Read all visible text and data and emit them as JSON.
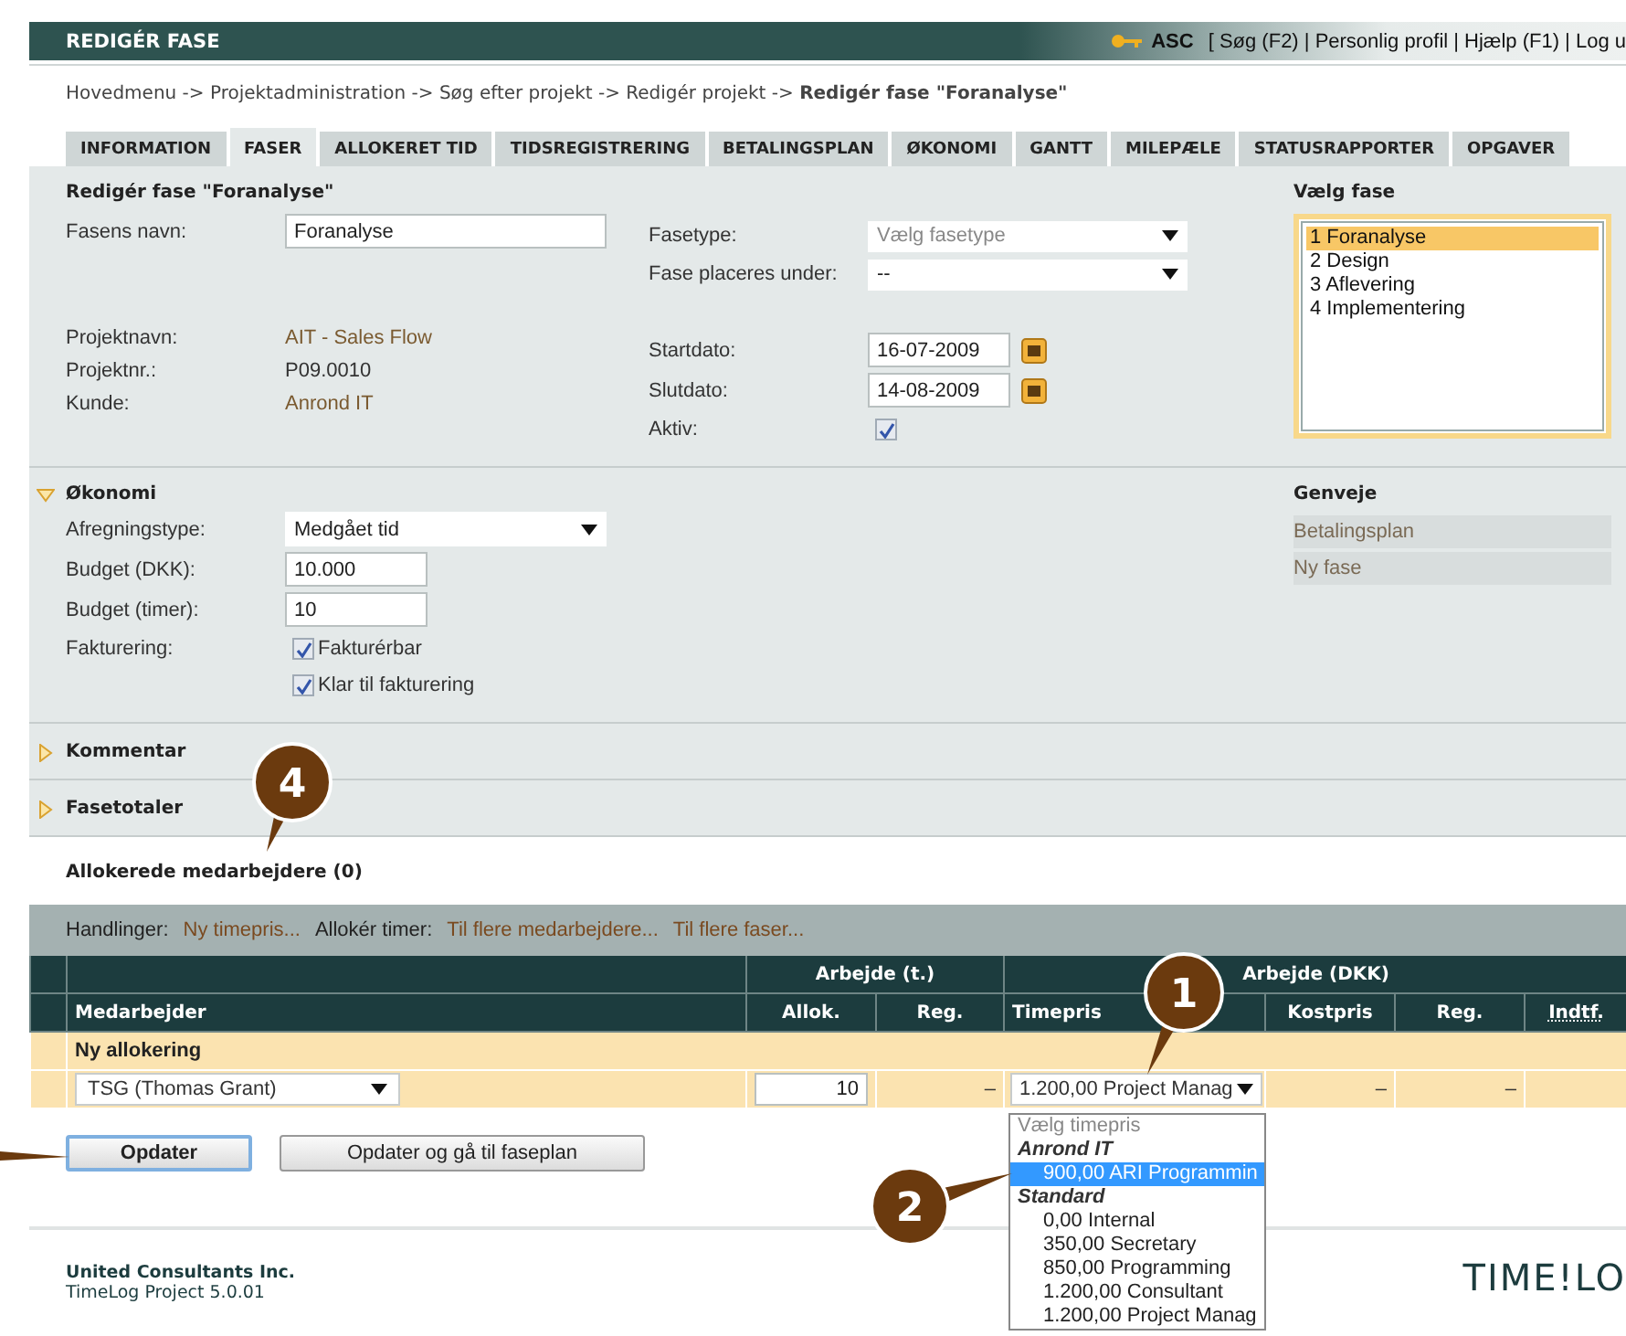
{
  "header": {
    "title": "REDIGÉR FASE",
    "user": "ASC",
    "links": "[ Søg (F2) | Personlig profil | Hjælp (F1) | Log u"
  },
  "breadcrumb": "Hovedmenu -> Projektadministration -> Søg efter projekt -> Redigér projekt -> **Redigér fase \"Foranalyse\"**",
  "tabs": [
    {
      "label": "INFORMATION",
      "selected": false
    },
    {
      "label": "FASER",
      "selected": true
    },
    {
      "label": "ALLOKERET TID",
      "selected": false
    },
    {
      "label": "TIDSREGISTRERING",
      "selected": false
    },
    {
      "label": "BETALINGSPLAN",
      "selected": false
    },
    {
      "label": "ØKONOMI",
      "selected": false
    },
    {
      "label": "GANTT",
      "selected": false
    },
    {
      "label": "MILEPÆLE",
      "selected": false
    },
    {
      "label": "STATUSRAPPORTER",
      "selected": false
    },
    {
      "label": "OPGAVER",
      "selected": false
    }
  ],
  "phase_form": {
    "title": "Redigér fase \"Foranalyse\"",
    "name": {
      "label": "Fasens navn:",
      "value": "Foranalyse"
    },
    "info": [
      {
        "label": "Projektnavn:",
        "value": "AIT - Sales Flow",
        "kind": "link"
      },
      {
        "label": "Projektnr.:",
        "value": "P09.0010",
        "kind": "text"
      },
      {
        "label": "Kunde:",
        "value": "Anrond IT",
        "kind": "link"
      }
    ],
    "phase_type": {
      "label": "Fasetype:",
      "placeholder": "Vælg fasetype"
    },
    "placed_under": {
      "label": "Fase placeres under:",
      "value": "--"
    },
    "start_date": {
      "label": "Startdato:",
      "value": "16-07-2009"
    },
    "end_date": {
      "label": "Slutdato:",
      "value": "14-08-2009"
    },
    "active": {
      "label": "Aktiv:",
      "checked": true
    }
  },
  "phase_picker": {
    "title": "Vælg fase",
    "items": [
      {
        "label": "1 Foranalyse",
        "selected": true
      },
      {
        "label": "2 Design",
        "selected": false
      },
      {
        "label": "3 Aflevering",
        "selected": false
      },
      {
        "label": "4 Implementering",
        "selected": false
      }
    ]
  },
  "economy": {
    "title": "Økonomi",
    "expanded": true,
    "billing_type": {
      "label": "Afregningstype:",
      "value": "Medgået tid"
    },
    "budget_dkk": {
      "label": "Budget (DKK):",
      "value": "10.000"
    },
    "budget_hours": {
      "label": "Budget (timer):",
      "value": "10"
    },
    "invoicing": {
      "label": "Fakturering:",
      "options": [
        {
          "label": "Fakturérbar",
          "checked": true
        },
        {
          "label": "Klar til fakturering",
          "checked": true
        }
      ]
    }
  },
  "shortcuts": {
    "title": "Genveje",
    "items": [
      "Betalingsplan",
      "Ny fase"
    ]
  },
  "collapsed_sections": [
    {
      "title": "Kommentar",
      "expanded": false
    },
    {
      "title": "Fasetotaler",
      "expanded": false
    }
  ],
  "allocations": {
    "title": "Allokerede medarbejdere (0)",
    "actions": [
      {
        "kind": "label",
        "text": "Handlinger:"
      },
      {
        "kind": "link",
        "text": "Ny timepris..."
      },
      {
        "kind": "label",
        "text": "Allokér timer:"
      },
      {
        "kind": "link",
        "text": "Til flere medarbejdere..."
      },
      {
        "kind": "link",
        "text": "Til flere faser..."
      }
    ],
    "group_headers": [
      "Arbejde (t.)",
      "Arbejde (DKK)"
    ],
    "columns": [
      "Medarbejder",
      "Allok.",
      "Reg.",
      "Timepris",
      "Kostpris",
      "Reg.",
      "Indtf."
    ],
    "new_row_title": "Ny allokering",
    "new_row": {
      "employee": "TSG (Thomas Grant)",
      "allocated": "10",
      "registered": "–",
      "rate": "1.200,00 Project Manag",
      "cost": "–",
      "registered_dkk": "–"
    },
    "rate_dropdown": {
      "expanded": true,
      "items": [
        {
          "kind": "placeholder",
          "label": "Vælg timepris",
          "selected": false
        },
        {
          "kind": "group",
          "label": "Anrond IT",
          "selected": false
        },
        {
          "kind": "option",
          "label": "900,00 ARI Programmin",
          "selected": true
        },
        {
          "kind": "group",
          "label": "Standard",
          "selected": false
        },
        {
          "kind": "option",
          "label": "0,00 Internal",
          "selected": false
        },
        {
          "kind": "option",
          "label": "350,00 Secretary",
          "selected": false
        },
        {
          "kind": "option",
          "label": "850,00 Programming",
          "selected": false
        },
        {
          "kind": "option",
          "label": "1.200,00 Consultant",
          "selected": false
        },
        {
          "kind": "option",
          "label": "1.200,00 Project Manag",
          "selected": false
        }
      ]
    }
  },
  "buttons": [
    {
      "label": "Opdater",
      "kind": "primary"
    },
    {
      "label": "Opdater og gå til faseplan",
      "kind": "secondary"
    }
  ],
  "footer": {
    "company": "United Consultants Inc.",
    "version": "TimeLog Project 5.0.01",
    "logo": "TIME!LO"
  },
  "callouts": [
    {
      "number": "4"
    },
    {
      "number": "1"
    },
    {
      "number": "2"
    }
  ]
}
